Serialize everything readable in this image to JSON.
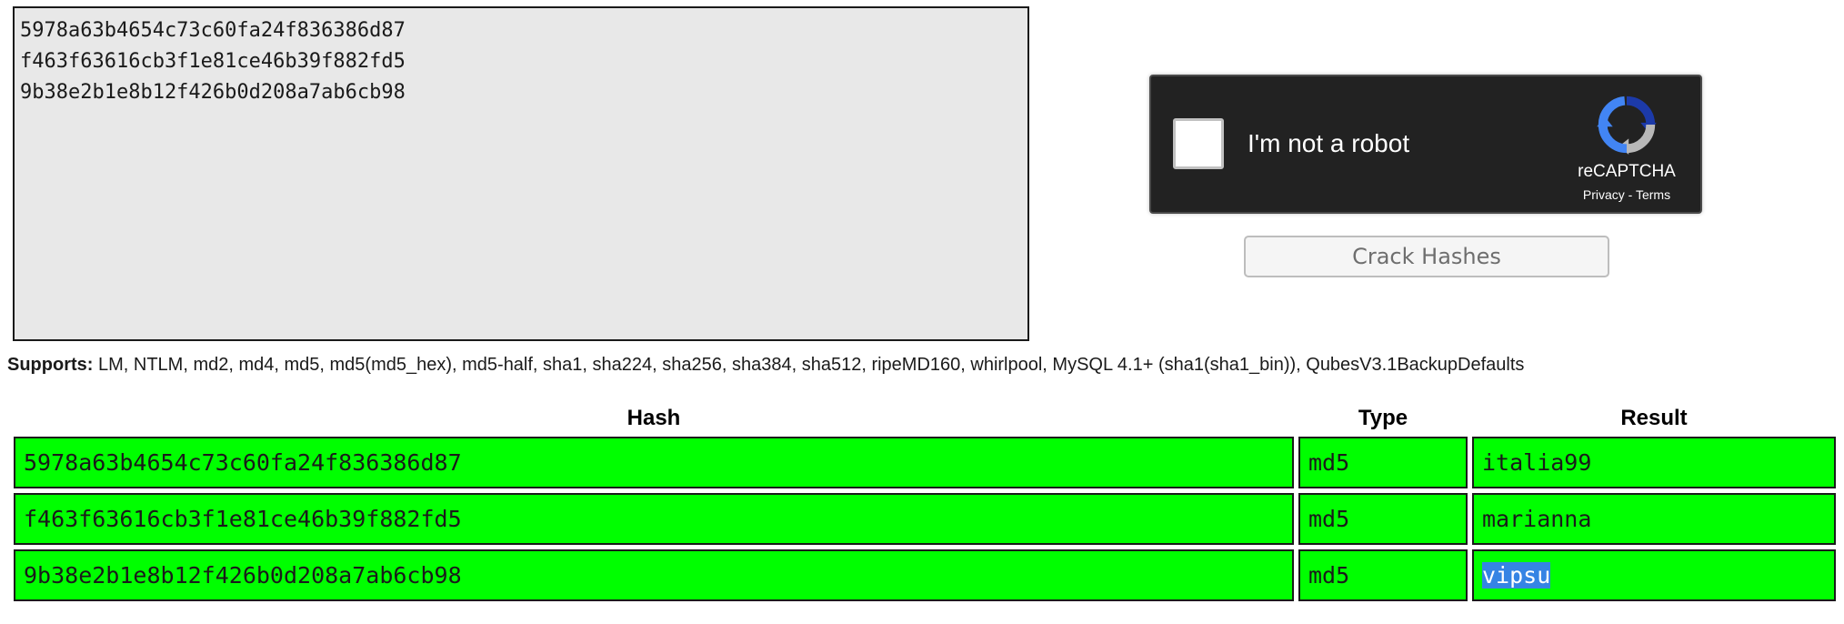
{
  "hash_input": {
    "value": "5978a63b4654c73c60fa24f836386d87\nf463f63616cb3f1e81ce46b39f882fd5\n9b38e2b1e8b12f426b0d208a7ab6cb98"
  },
  "recaptcha": {
    "label": "I'm not a robot",
    "brand": "reCAPTCHA",
    "privacy": "Privacy",
    "separator": " - ",
    "terms": "Terms",
    "theme": "dark"
  },
  "crack_button": {
    "label": "Crack Hashes"
  },
  "supports": {
    "label": "Supports:",
    "text": " LM, NTLM, md2, md4, md5, md5(md5_hex), md5-half, sha1, sha224, sha256, sha384, sha512, ripeMD160, whirlpool, MySQL 4.1+ (sha1(sha1_bin)), QubesV3.1BackupDefaults"
  },
  "results_table": {
    "columns": [
      "Hash",
      "Type",
      "Result"
    ],
    "rows": [
      {
        "hash": "5978a63b4654c73c60fa24f836386d87",
        "type": "md5",
        "result": "italia99",
        "status": "cracked"
      },
      {
        "hash": "f463f63616cb3f1e81ce46b39f882fd5",
        "type": "md5",
        "result": "marianna",
        "status": "cracked"
      },
      {
        "hash": "9b38e2b1e8b12f426b0d208a7ab6cb98",
        "type": "md5",
        "result": "vipsu",
        "status": "cracked",
        "selected": true
      }
    ],
    "success_color": "#00ff00",
    "selection_color": "#3584e4"
  }
}
